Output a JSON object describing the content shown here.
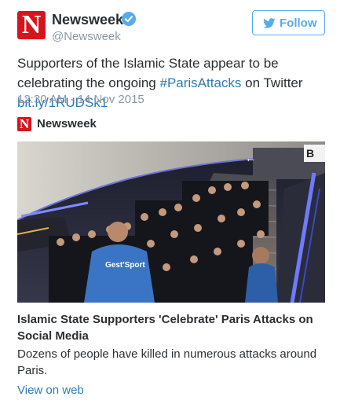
{
  "author": {
    "display_name": "Newsweek",
    "screen_name": "@Newsweek",
    "avatar_letter": "N",
    "verified_icon": "verified-badge-icon",
    "brand_color": "#d7141a"
  },
  "follow_button": {
    "label": "Follow",
    "icon": "twitter-bird-icon",
    "color": "#55acee"
  },
  "tweet": {
    "text_before_hashtag": "Supporters of the Islamic State appear to be celebrating the ongoing ",
    "hashtag": "#ParisAttacks",
    "text_after_hashtag": " on Twitter ",
    "link": "bit.ly/1RUDSk1",
    "timestamp": "12:30 AM - 14 Nov 2015",
    "link_color": "#2b7bb9"
  },
  "card": {
    "site_name": "Newsweek",
    "logo_letter": "N",
    "image_text": {
      "jacket_text": "Gest'Sport",
      "sign_letters": "B",
      "sign_arrow": "←"
    },
    "title": "Islamic State Supporters 'Celebrate' Paris Attacks on Social Media",
    "description": "Dozens of people have killed in numerous attacks around Paris.",
    "view_link": "View on web"
  }
}
